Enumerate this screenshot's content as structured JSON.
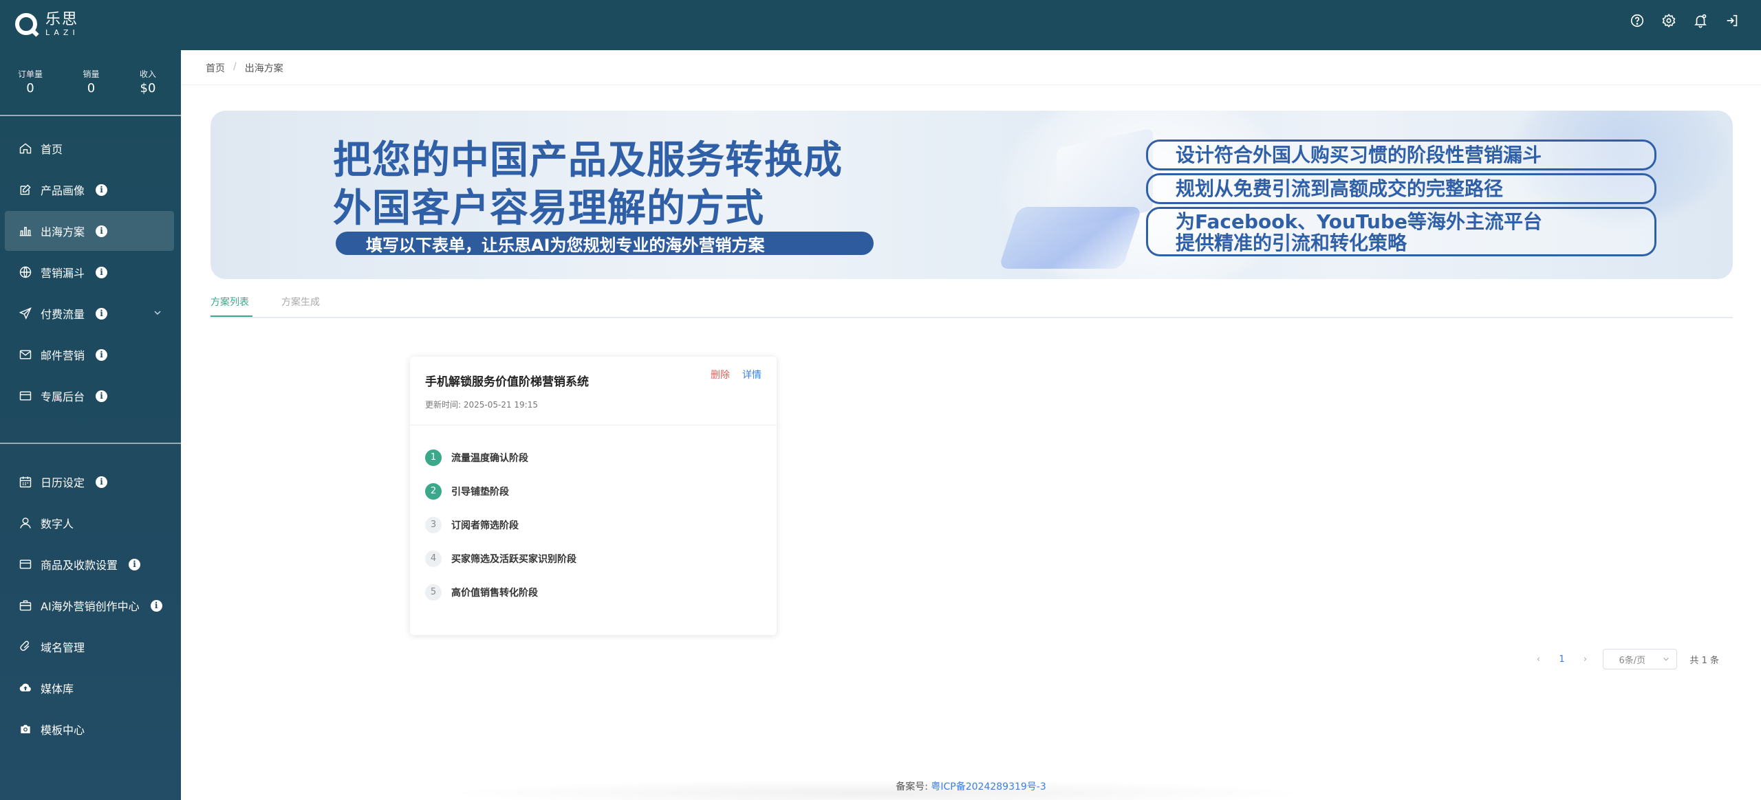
{
  "app": {
    "logo_cn": "乐思",
    "logo_en": "LAZI"
  },
  "topbar": {
    "icons": [
      "help-icon",
      "settings-icon",
      "bell-icon",
      "logout-icon"
    ]
  },
  "stats": [
    {
      "label": "订单量",
      "value": "0"
    },
    {
      "label": "销量",
      "value": "0"
    },
    {
      "label": "收入",
      "value": "$0"
    }
  ],
  "nav": {
    "items": [
      {
        "label": "首页",
        "icon": "home-icon"
      },
      {
        "label": "产品画像",
        "icon": "edit-icon",
        "info": "i"
      },
      {
        "label": "出海方案",
        "icon": "bar-chart-icon",
        "info": "i",
        "active": true
      },
      {
        "label": "营销漏斗",
        "icon": "globe-icon",
        "info": "i"
      },
      {
        "label": "付费流量",
        "icon": "send-icon",
        "info": "i"
      },
      {
        "label": "邮件营销",
        "icon": "mail-icon",
        "info": "i"
      },
      {
        "label": "专属后台",
        "icon": "card-icon",
        "info": "i"
      }
    ],
    "items2": [
      {
        "label": "日历设定",
        "icon": "calendar-icon",
        "info": "i"
      },
      {
        "label": "数字人",
        "icon": "user-icon"
      },
      {
        "label": "商品及收款设置",
        "icon": "card-icon",
        "info": "i"
      },
      {
        "label": "AI海外营销创作中心",
        "icon": "briefcase-icon",
        "info": "i"
      },
      {
        "label": "域名管理",
        "icon": "link-icon"
      },
      {
        "label": "媒体库",
        "icon": "cloud-upload-icon"
      },
      {
        "label": "模板中心",
        "icon": "camera-icon"
      }
    ]
  },
  "breadcrumb": {
    "home": "首页",
    "sep": "/",
    "current": "出海方案"
  },
  "banner": {
    "headline_1": "把您的中国产品及服务转换成",
    "headline_2": "外国客户容易理解的方式",
    "pill": "填写以下表单，让乐思AI为您规划专业的海外营销方案",
    "box_1": "设计符合外国人购买习惯的阶段性营销漏斗",
    "box_2": "规划从免费引流到高额成交的完整路径",
    "box_3_line1": "为Facebook、YouTube等海外主流平台",
    "box_3_line2": "提供精准的引流和转化策略"
  },
  "tabs": {
    "list": "方案列表",
    "generate": "方案生成"
  },
  "card": {
    "title": "手机解锁服务价值阶梯营销系统",
    "updated": "更新时间: 2025-05-21 19:15",
    "delete": "删除",
    "detail": "详情",
    "steps": [
      {
        "num": "1",
        "label": "流量温度确认阶段",
        "done": true
      },
      {
        "num": "2",
        "label": "引导铺垫阶段",
        "done": true
      },
      {
        "num": "3",
        "label": "订阅者筛选阶段",
        "done": false
      },
      {
        "num": "4",
        "label": "买家筛选及活跃买家识别阶段",
        "done": false
      },
      {
        "num": "5",
        "label": "高价值销售转化阶段",
        "done": false
      }
    ]
  },
  "pager": {
    "prev": "‹",
    "page": "1",
    "next": "›",
    "size": "6条/页",
    "total": "共 1 条"
  },
  "footer": {
    "label": "备案号:",
    "icp": "粤ICP备2024289319号-3"
  },
  "colors": {
    "sidebar": "#1d4b5e",
    "accent": "#3aa88a",
    "link": "#3b7fe0",
    "danger": "#e0605a",
    "banner_text": "#2f5fa6"
  }
}
